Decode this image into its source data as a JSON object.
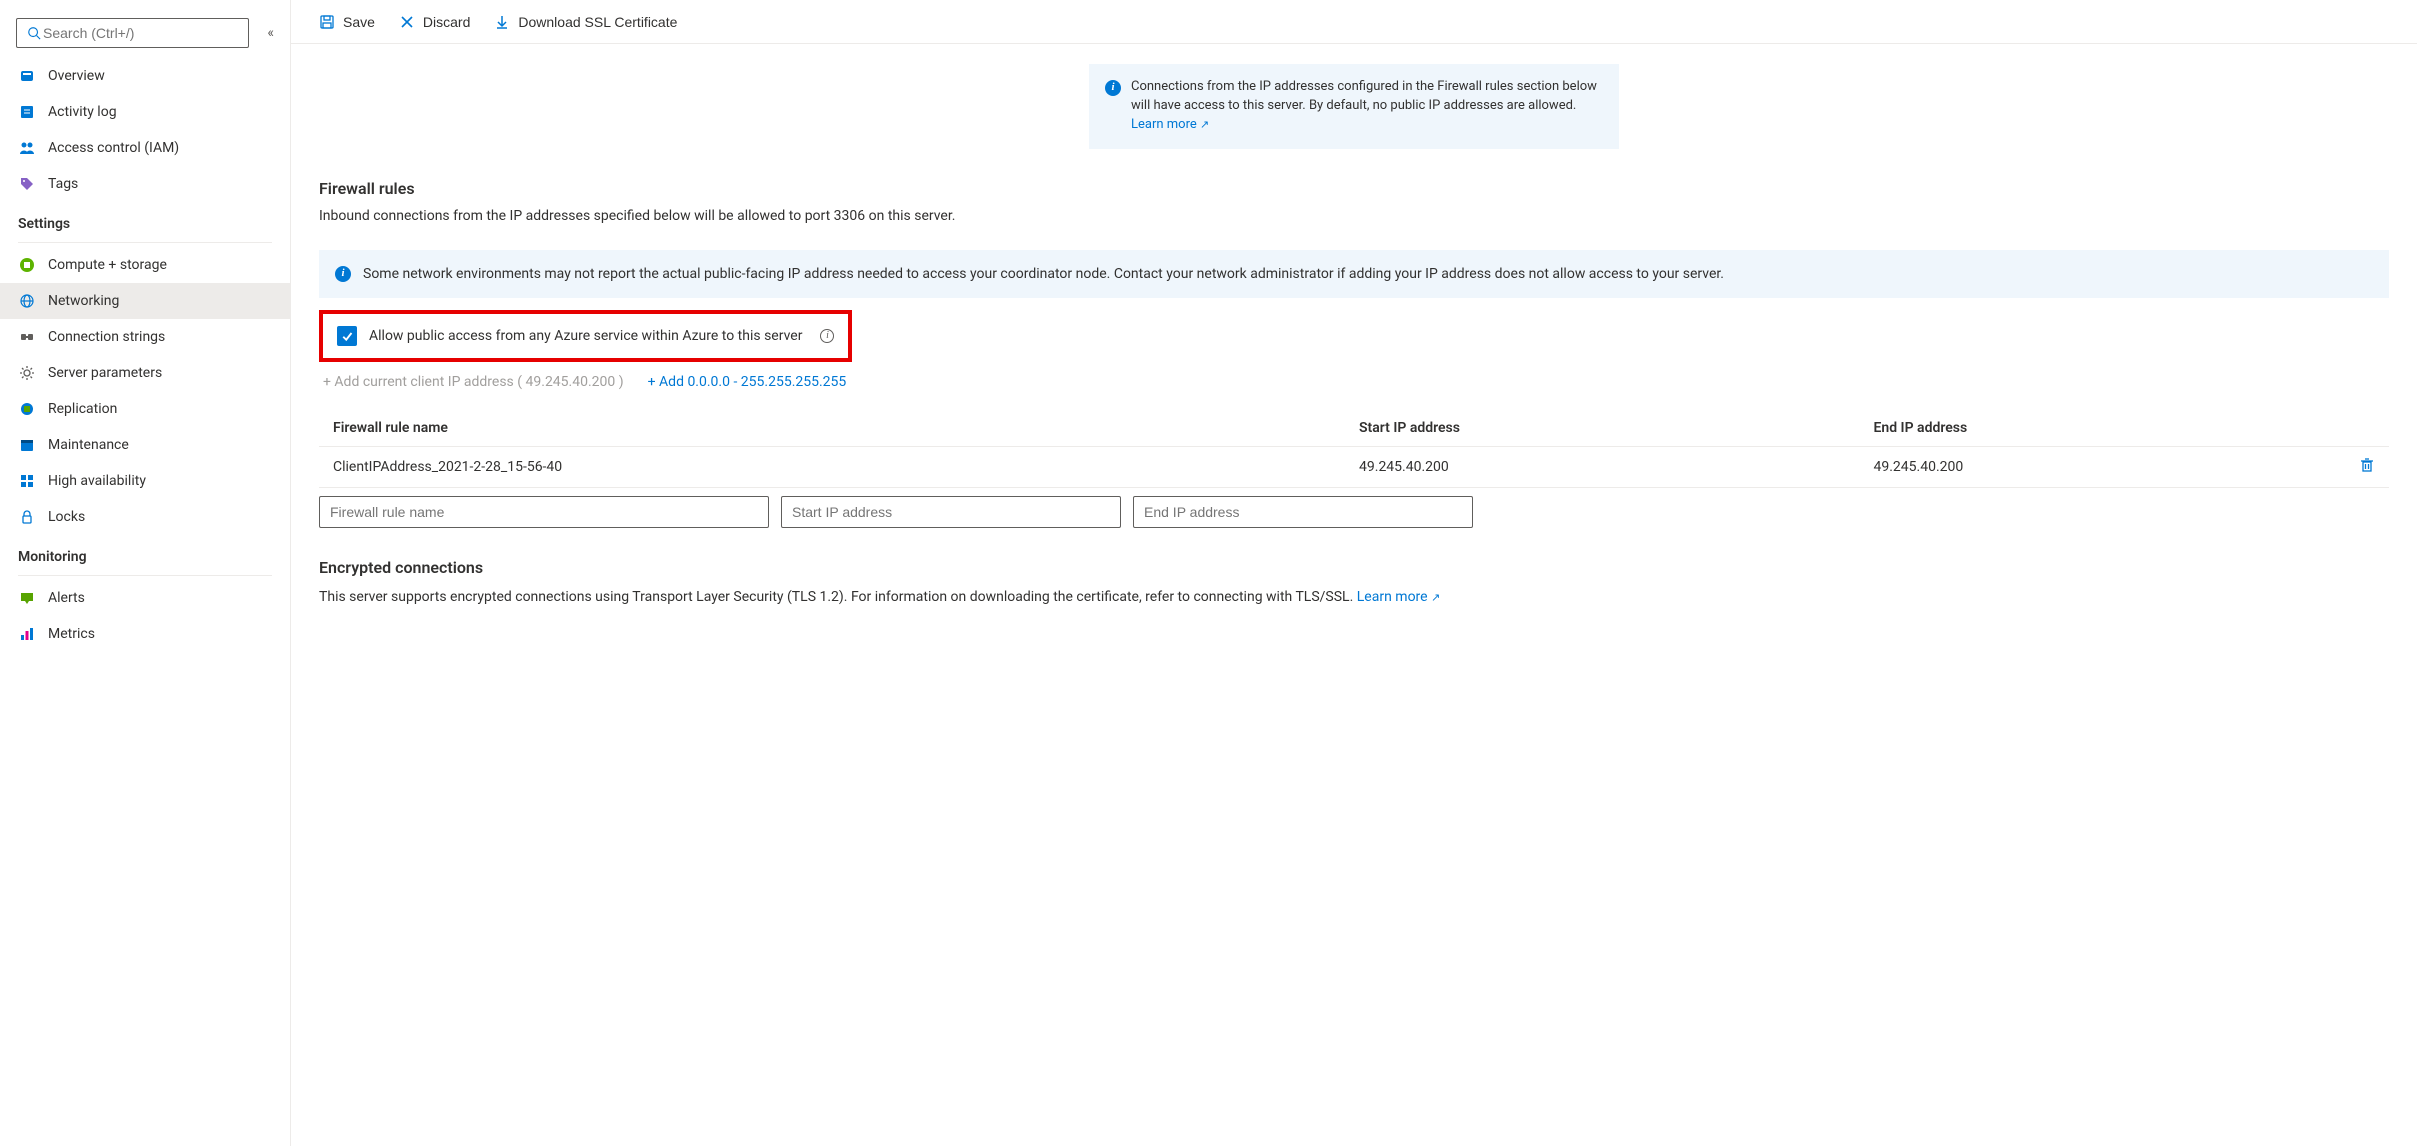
{
  "search": {
    "placeholder": "Search (Ctrl+/)"
  },
  "sidebar": {
    "top": [
      {
        "label": "Overview"
      },
      {
        "label": "Activity log"
      },
      {
        "label": "Access control (IAM)"
      },
      {
        "label": "Tags"
      }
    ],
    "settings_title": "Settings",
    "settings": [
      {
        "label": "Compute + storage"
      },
      {
        "label": "Networking"
      },
      {
        "label": "Connection strings"
      },
      {
        "label": "Server parameters"
      },
      {
        "label": "Replication"
      },
      {
        "label": "Maintenance"
      },
      {
        "label": "High availability"
      },
      {
        "label": "Locks"
      }
    ],
    "monitoring_title": "Monitoring",
    "monitoring": [
      {
        "label": "Alerts"
      },
      {
        "label": "Metrics"
      }
    ]
  },
  "toolbar": {
    "save": "Save",
    "discard": "Discard",
    "download": "Download SSL Certificate"
  },
  "info_top": {
    "text": "Connections from the IP addresses configured in the Firewall rules section below will have access to this server. By default, no public IP addresses are allowed. ",
    "learn_more": "Learn more"
  },
  "firewall": {
    "title": "Firewall rules",
    "desc": "Inbound connections from the IP addresses specified below will be allowed to port 3306 on this server.",
    "info_wide": "Some network environments may not report the actual public-facing IP address needed to access your coordinator node. Contact your network administrator if adding your IP address does not allow access to your server.",
    "allow_azure_label": "Allow public access from any Azure service within Azure to this server",
    "add_current": "+ Add current client IP address ( 49.245.40.200 )",
    "add_all": "+ Add 0.0.0.0 - 255.255.255.255",
    "headers": {
      "name": "Firewall rule name",
      "start": "Start IP address",
      "end": "End IP address"
    },
    "rows": [
      {
        "name": "ClientIPAddress_2021-2-28_15-56-40",
        "start": "49.245.40.200",
        "end": "49.245.40.200"
      }
    ],
    "placeholders": {
      "name": "Firewall rule name",
      "start": "Start IP address",
      "end": "End IP address"
    }
  },
  "encrypted": {
    "title": "Encrypted connections",
    "text": "This server supports encrypted connections using Transport Layer Security (TLS 1.2). For information on downloading the certificate, refer to connecting with TLS/SSL. ",
    "learn_more": "Learn more"
  }
}
